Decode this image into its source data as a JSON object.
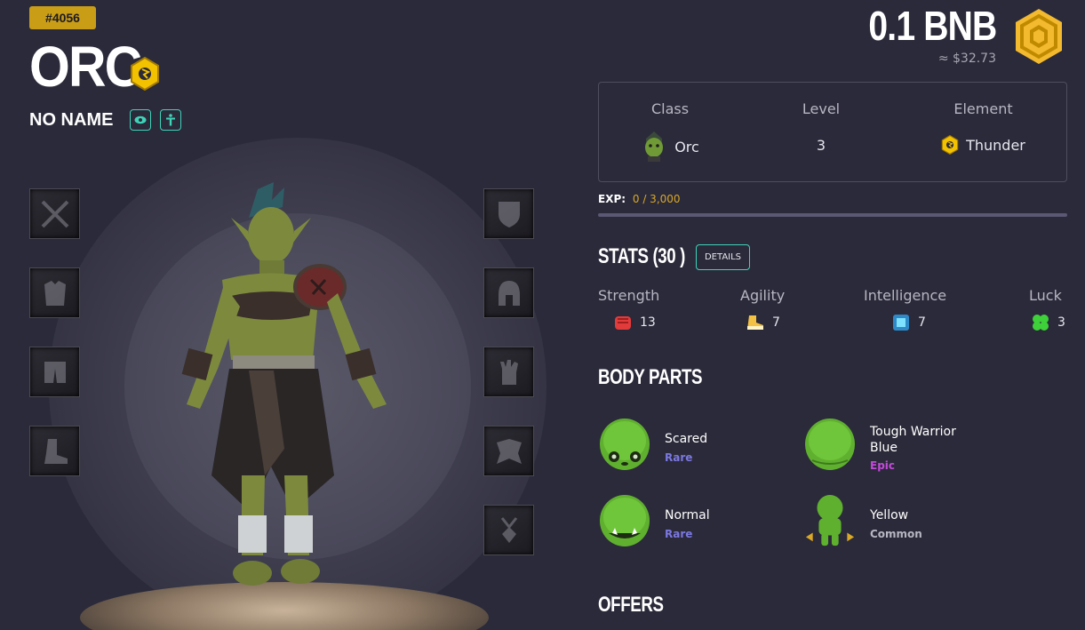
{
  "hero": {
    "id": "#4056",
    "name": "ORC",
    "nickname": "NO NAME",
    "element_icon": "thunder-element-icon"
  },
  "price": {
    "amount": "0.1 BNB",
    "usd": "≈ $32.73",
    "currency_icon": "bnb-logo-icon"
  },
  "info": {
    "class_label": "Class",
    "class_value": "Orc",
    "level_label": "Level",
    "level_value": "3",
    "element_label": "Element",
    "element_value": "Thunder"
  },
  "exp": {
    "label": "EXP:",
    "value": "0 / 3,000",
    "progress": 0
  },
  "stats": {
    "title": "STATS (30 )",
    "details_label": "DETAILS",
    "items": [
      {
        "name": "Strength",
        "value": "13",
        "icon": "fist-icon"
      },
      {
        "name": "Agility",
        "value": "7",
        "icon": "boot-icon"
      },
      {
        "name": "Intelligence",
        "value": "7",
        "icon": "gem-icon"
      },
      {
        "name": "Luck",
        "value": "3",
        "icon": "clover-icon"
      }
    ]
  },
  "body_parts": {
    "title": "BODY PARTS",
    "items": [
      {
        "name": "Scared",
        "rarity": "Rare"
      },
      {
        "name": "Tough Warrior Blue",
        "rarity": "Epic"
      },
      {
        "name": "Normal",
        "rarity": "Rare"
      },
      {
        "name": "Yellow",
        "rarity": "Common"
      }
    ]
  },
  "offers": {
    "title": "OFFERS"
  },
  "colors": {
    "gold": "#c99d16",
    "teal": "#3fd3b8",
    "rare": "#7b78e0",
    "epic": "#c24ad8",
    "common": "#b7b6c3"
  },
  "equipment_slots": {
    "left": [
      "weapon-slot-icon",
      "armor-slot-icon",
      "pants-slot-icon",
      "boots-slot-icon"
    ],
    "right": [
      "shield-slot-icon",
      "helmet-slot-icon",
      "gloves-slot-icon",
      "cape-slot-icon",
      "amulet-slot-icon"
    ]
  }
}
